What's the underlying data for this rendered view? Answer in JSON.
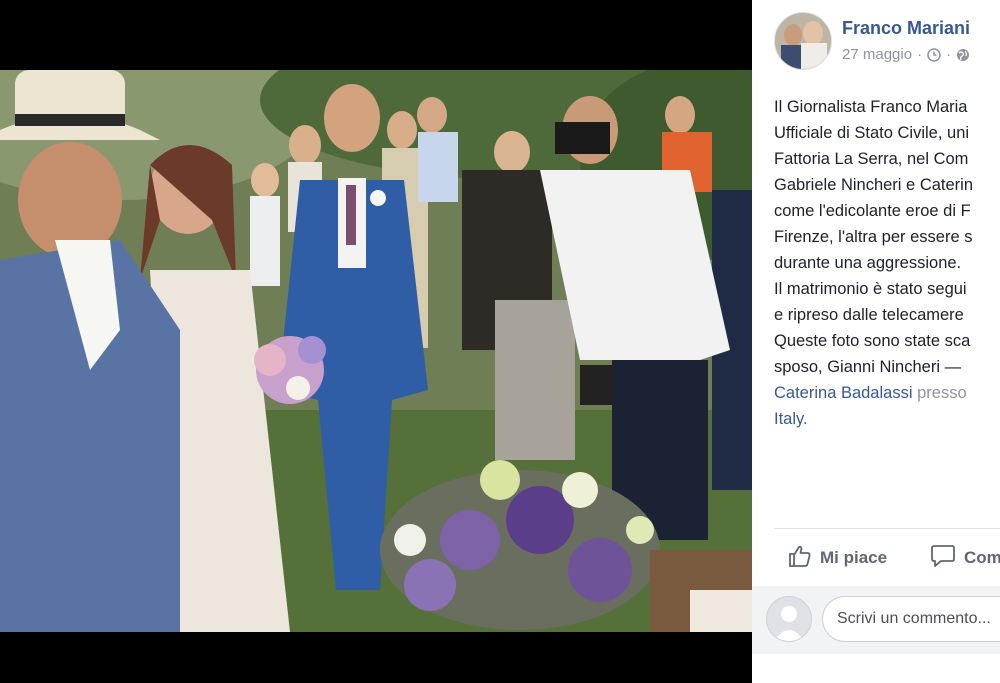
{
  "photo": {
    "alt_subject": "wedding-photo"
  },
  "post": {
    "author": "Franco Mariani",
    "date": "27 maggio",
    "separator": "·",
    "text_lines": [
      "Il Giornalista Franco Maria",
      "Ufficiale di Stato Civile, uni",
      "Fattoria La Serra, nel Com",
      "Gabriele Nincheri e Caterin",
      "come l'edicolante eroe di F",
      "Firenze, l'altra per essere s",
      "durante una aggressione.",
      "Il matrimonio è stato segui",
      "e ripreso dalle telecamere",
      "Queste foto sono state sca",
      "sposo, Gianni Nincheri — "
    ],
    "tagged_person": "Caterina Badalassi",
    "location_prefix": "presso",
    "location": "Italy."
  },
  "actions": {
    "like_label": "Mi piace",
    "comment_label": "Com"
  },
  "comment_box": {
    "placeholder": "Scrivi un commento..."
  },
  "colors": {
    "link": "#365899",
    "muted": "#90949c",
    "text": "#1d2129"
  },
  "icons": [
    "clock-icon",
    "globe-icon",
    "like-thumb-icon",
    "comment-bubble-icon"
  ]
}
